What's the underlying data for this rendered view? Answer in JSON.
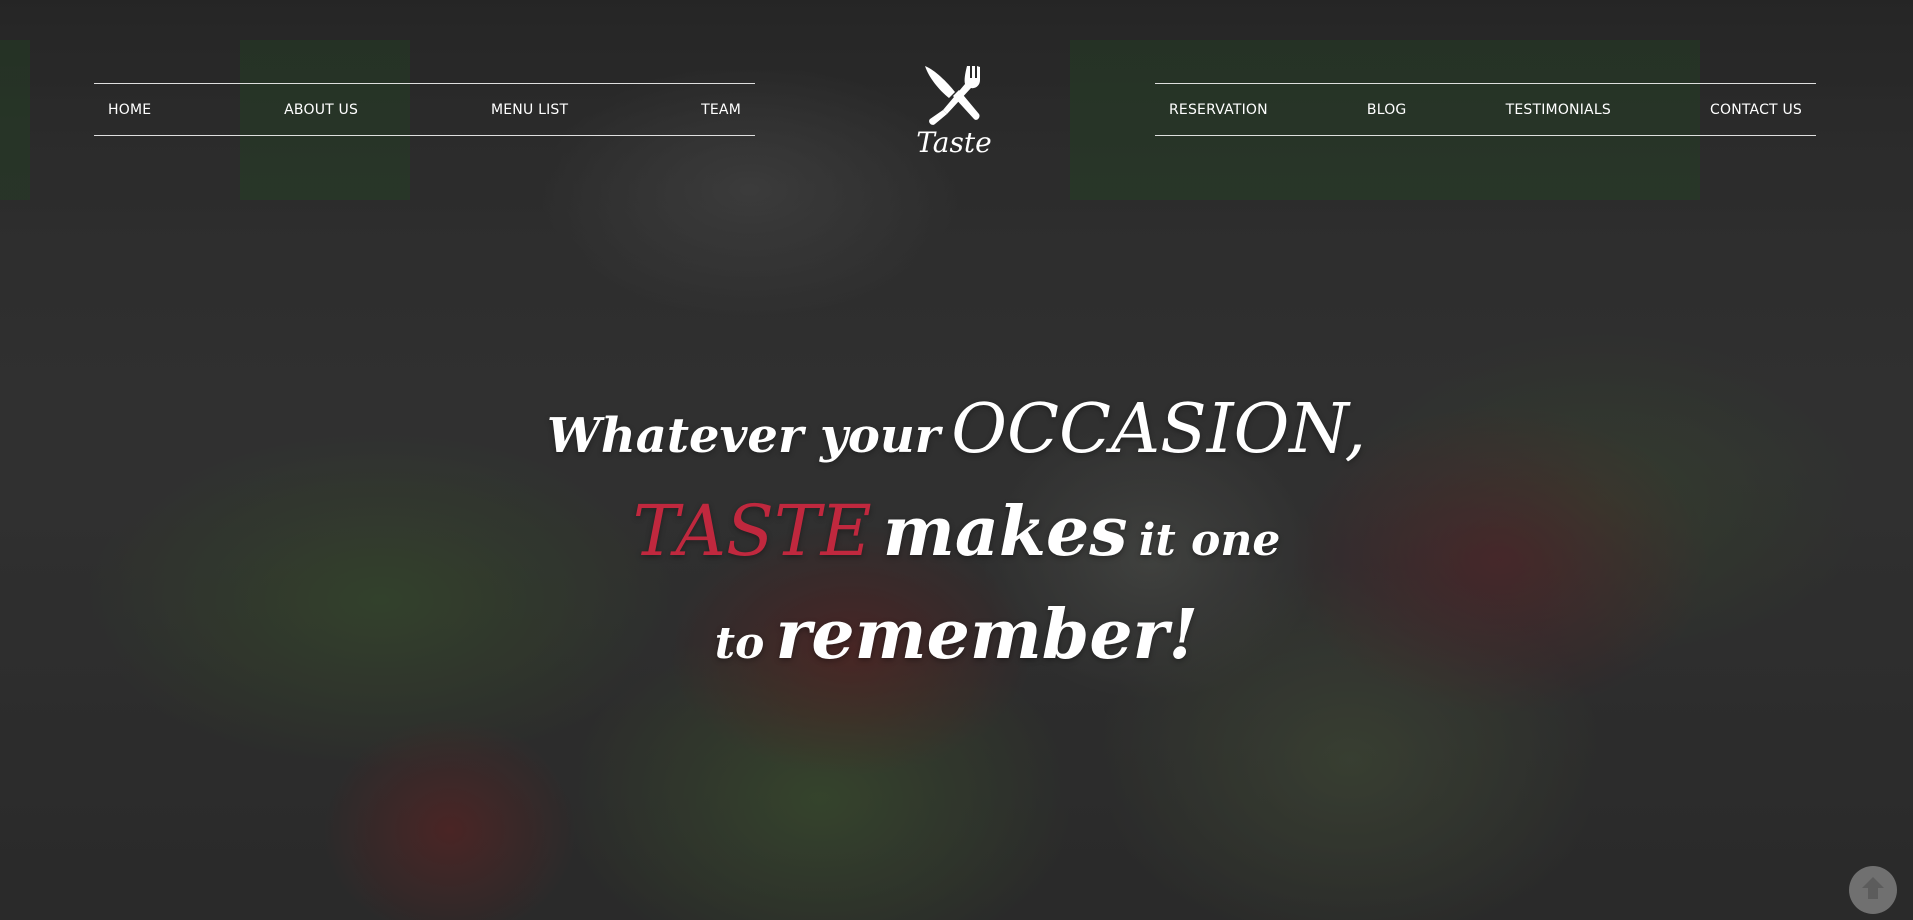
{
  "nav": {
    "left": [
      "HOME",
      "ABOUT US",
      "MENU LIST",
      "TEAM"
    ],
    "right": [
      "RESERVATION",
      "BLOG",
      "TESTIMONIALS",
      "CONTACT US"
    ]
  },
  "logo": {
    "text": "Taste",
    "icon": "crossed-knife-fork-icon"
  },
  "headline": {
    "line1_part1": "Whatever your",
    "line1_part2": "OCCASION,",
    "line2_brand": "TASTE",
    "line2_part2": "makes",
    "line2_part3": "it one",
    "line3_part1": "to",
    "line3_part2": "remember!"
  },
  "back_to_top": {
    "icon": "arrow-up-icon"
  },
  "colors": {
    "accent": "#c0283e",
    "text": "#ffffff"
  }
}
